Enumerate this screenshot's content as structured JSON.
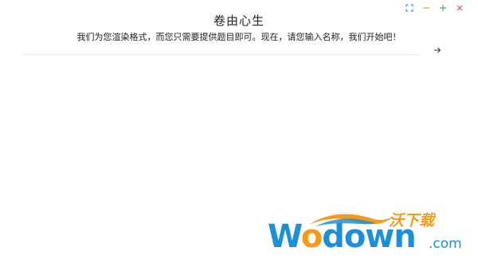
{
  "window": {
    "controls": [
      {
        "name": "fullscreen-icon",
        "color": "#2b8fd8"
      },
      {
        "name": "minimize-icon",
        "color": "#e8a33d"
      },
      {
        "name": "maximize-icon",
        "color": "#3cb35a"
      },
      {
        "name": "close-icon",
        "color": "#e05252"
      }
    ]
  },
  "header": {
    "title": "卷由心生",
    "subtitle": "我们为您渲染格式，而您只需要提供题目即可。现在，请您输入名称，我们开始吧！"
  },
  "form": {
    "name_value": "",
    "name_placeholder": "",
    "go_icon": "arrow-right-icon"
  },
  "watermark": {
    "cn_text": "沃下载",
    "en_text_w": "W",
    "en_text_o1": "o",
    "en_text_rest": "down",
    "com_text": ".com",
    "colors": {
      "blue": "#1c8fd8",
      "orange": "#f39a1a"
    }
  }
}
